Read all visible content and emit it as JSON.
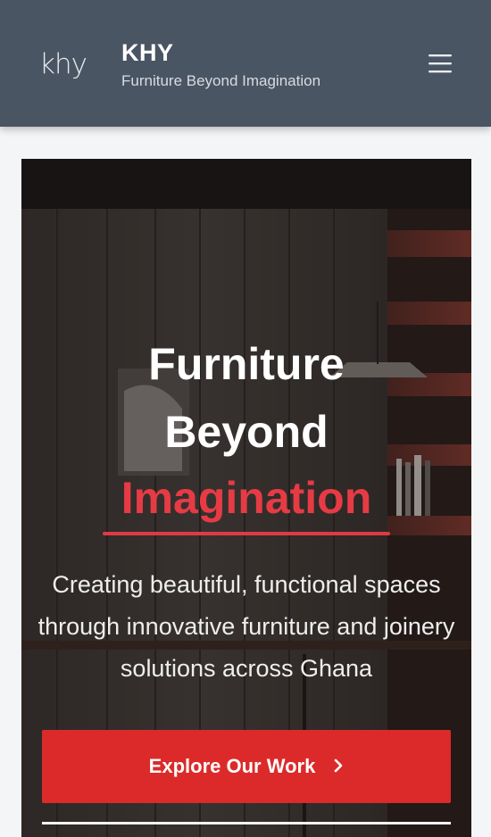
{
  "header": {
    "logo_text": "khy",
    "title": "KHY",
    "tagline": "Furniture Beyond Imagination",
    "menu_icon": "hamburger-menu-icon"
  },
  "hero": {
    "headline_line1": "Furniture",
    "headline_line2": "Beyond",
    "headline_accent": "Imagination",
    "subtext": "Creating beautiful, functional spaces through innovative furniture and joinery solutions across Ghana",
    "cta_label": "Explore Our Work",
    "cta_icon": "chevron-right-icon"
  },
  "colors": {
    "header_bg": "#4a5563",
    "accent": "#e63b45",
    "cta_bg": "#dc2a2a",
    "page_bg": "#f4f5f7"
  }
}
